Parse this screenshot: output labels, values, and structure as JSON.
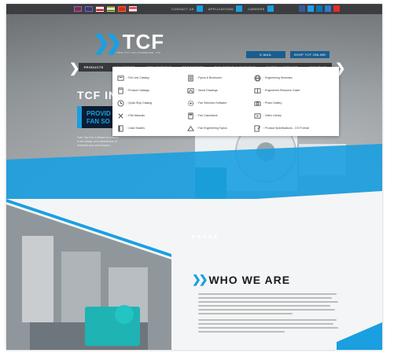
{
  "utility_bar": {
    "flags": [
      {
        "name": "usa-flag",
        "colors": [
          "#2b3f8f",
          "#c8102e"
        ]
      },
      {
        "name": "uk-flag",
        "colors": [
          "#1f3b86",
          "#c8102e"
        ]
      },
      {
        "name": "czech-flag",
        "colors": [
          "#ffffff",
          "#d7141a"
        ]
      },
      {
        "name": "india-flag",
        "colors": [
          "#ff9933",
          "#138808"
        ]
      },
      {
        "name": "china-flag",
        "colors": [
          "#de2910",
          "#de2910"
        ]
      },
      {
        "name": "singapore-flag",
        "colors": [
          "#ef3340",
          "#ffffff"
        ]
      }
    ],
    "links": [
      {
        "label": "CONTACT US"
      },
      {
        "label": "APPLICATIONS"
      },
      {
        "label": "CAREERS"
      }
    ],
    "socials": [
      {
        "name": "facebook-icon",
        "color": "#3b5998"
      },
      {
        "name": "twitter-icon",
        "color": "#1da1f2"
      },
      {
        "name": "linkedin-icon",
        "color": "#0077b5"
      },
      {
        "name": "google-plus-icon",
        "color": "#2a7bd4"
      },
      {
        "name": "youtube-icon",
        "color": "#e52d27"
      }
    ]
  },
  "header": {
    "logo_text": "TCF",
    "logo_sub": "TWIN CITY FAN COMPANIES, LTD.",
    "buttons": [
      {
        "label": "E-MAIL"
      },
      {
        "label": "SHOP TCF ONLINE"
      }
    ]
  },
  "nav": {
    "items": [
      {
        "label": "PRODUCTS"
      },
      {
        "label": "INDUSTRIES"
      },
      {
        "label": "APPLICATIONS"
      },
      {
        "label": "RESOURCES"
      },
      {
        "label": "FAN SIZING & SURVEYS"
      },
      {
        "label": "PARTS & SERVICE"
      },
      {
        "label": "ABOUT US"
      }
    ]
  },
  "hero": {
    "title": "TCF IN",
    "subtitle_line1": "PROVID",
    "subtitle_line2": "FAN SO",
    "body": "Twin City Fan & Blower is a leader in the design and manufacture of industrial fans and blowers..."
  },
  "mega_menu": {
    "columns": [
      [
        {
          "label": "Full Line Catalog",
          "icon": "catalog-icon"
        },
        {
          "label": "Product Catalogs",
          "icon": "book-icon"
        },
        {
          "label": "Quick Ship Catalog",
          "icon": "clock-icon"
        },
        {
          "label": "IOM Manuals",
          "icon": "wrench-icon"
        },
        {
          "label": "Case Studies",
          "icon": "case-study-icon"
        }
      ],
      [
        {
          "label": "Flyers & Brochures",
          "icon": "brochure-icon"
        },
        {
          "label": "Worst Drawings",
          "icon": "drawing-icon"
        },
        {
          "label": "Fan Selection Software",
          "icon": "gear-icon"
        },
        {
          "label": "Fan Calculators",
          "icon": "calculator-icon"
        },
        {
          "label": "Fan Engineering Topics",
          "icon": "engineering-icon"
        }
      ],
      [
        {
          "label": "Engineering Seminars",
          "icon": "globe-icon"
        },
        {
          "label": "Engineered Resource Guide",
          "icon": "guide-icon"
        },
        {
          "label": "Photo Gallery",
          "icon": "camera-icon"
        },
        {
          "label": "Video Library",
          "icon": "video-icon"
        },
        {
          "label": "Product Specifications - CSI Format",
          "icon": "specs-icon"
        }
      ]
    ]
  },
  "about": {
    "title": "WHO WE ARE"
  },
  "colors": {
    "accent": "#1a9fe0",
    "dark": "#3c3d40",
    "navy": "#0b1d33"
  }
}
